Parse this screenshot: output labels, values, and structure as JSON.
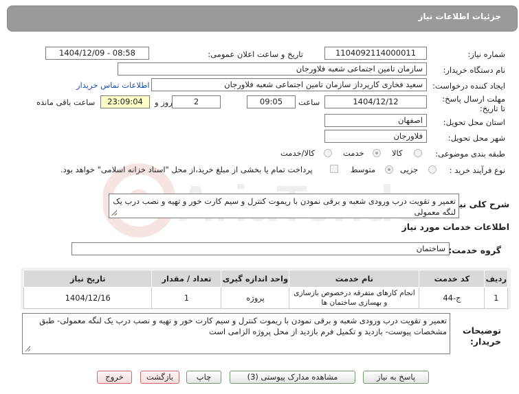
{
  "panel": {
    "title": "جزئیات اطلاعات نیاز"
  },
  "labels": {
    "need_number": "شماره نیاز:",
    "announce_datetime": "تاریخ و ساعت اعلان عمومی:",
    "buyer_org": "نام دستگاه خریدار:",
    "request_creator": "ایجاد کننده درخواست:",
    "deadline": "مهلت ارسال پاسخ: تا تاریخ:",
    "time_word": "ساعت",
    "day_and": "روز و",
    "time_remaining": "ساعت باقی مانده",
    "province": "استان محل تحویل:",
    "city": "شهر محل تحویل:",
    "category": "طبقه بندی موضوعی:",
    "process_type": "نوع فرآیند خرید :",
    "general_description": "شرح کلی نیاز:",
    "services_info": "اطلاعات خدمات مورد نیاز",
    "service_group": "گروه خدمت:",
    "buyer_notes": "توضیحات خریدار:"
  },
  "fields": {
    "need_number": "1104092114000011",
    "announce_datetime": "1404/12/09 - 08:58",
    "buyer_org": "سازمان تامین اجتماعی شعبه فلاورجان",
    "request_creator": "سعید فخاری کارپرداز سازمان تامین اجتماعی شعبه فلاورجان",
    "contact_link": "اطلاعات تماس خریدار",
    "deadline_date": "1404/12/12",
    "deadline_time": "09:05",
    "days_remaining": "2",
    "time_remaining": "23:09:04",
    "province": "اصفهان",
    "city": "فلاورجان",
    "general_description": "تعمیر و تقویت درب ورودی شعبه و برقی نمودن با ریموت کنترل و سیم کارت خور و تهیه و نصب درب یک لنگه معمولی",
    "service_group": "ساختمان",
    "buyer_notes": "تعمیر و تقویت درب ورودی شعبه و برقی نمودن با ریموت کنترل و سیم کارت خور و تهیه و نصب درب یک لنگه معمولی- طبق مشخصات پیوست- بازدید و تکمیل فرم بازدید از محل پروژه الزامی است"
  },
  "category_options": [
    {
      "label": "کالا",
      "selected": false
    },
    {
      "label": "خدمت",
      "selected": true
    },
    {
      "label": "کالا/خدمت",
      "selected": false
    }
  ],
  "process_options": [
    {
      "label": "جزیی",
      "selected": false
    },
    {
      "label": "متوسط",
      "selected": true
    }
  ],
  "payment_note": "پرداخت تمام یا بخشی از مبلغ خرید،از محل \"اسناد خزانه اسلامی\" خواهد بود.",
  "table": {
    "headers": [
      "ردیف",
      "کد خدمت",
      "نام خدمت",
      "واحد اندازه گیری",
      "تعداد / مقدار",
      "تاریخ نیاز"
    ],
    "rows": [
      [
        "1",
        "ج-44",
        "انجام کارهای متفرقه درخصوص بازسازی و بهسازی ساختمان ها",
        "پروژه",
        "1",
        "1404/12/16"
      ]
    ]
  },
  "buttons": {
    "reply": "پاسخ به نیاز",
    "view_docs": "مشاهده مدارک پیوستی (3)",
    "print": "چاپ",
    "back": "بازگشت",
    "exit": "خروج"
  },
  "watermark": {
    "text": "AriaTender.net"
  },
  "colors": {
    "header_bg": "#9a9a9a",
    "highlight_field": "#fdfdc8",
    "link": "#1a4fb3",
    "table_header": "#d9d9d9"
  }
}
